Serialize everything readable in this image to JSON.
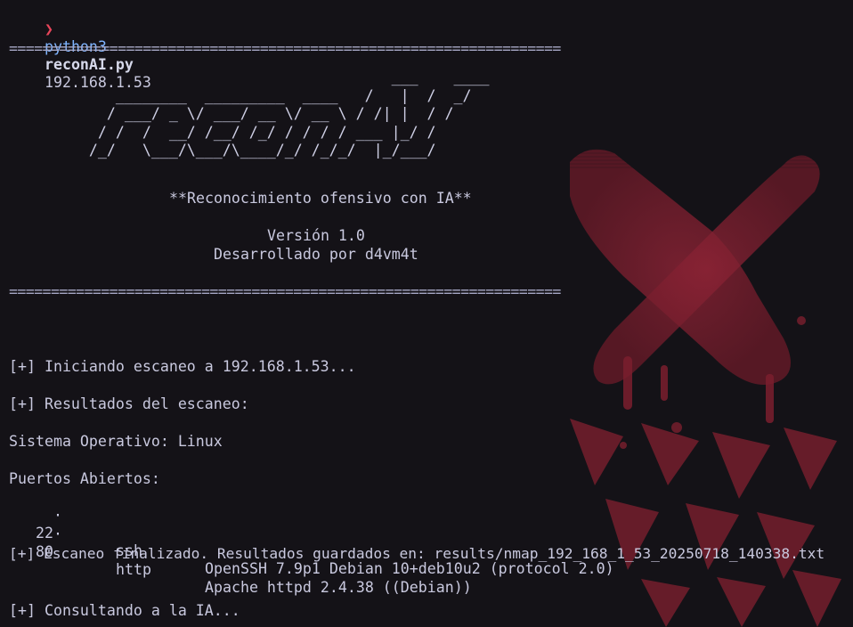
{
  "prompt": {
    "arrow": "❯",
    "command": "python3",
    "script": "reconAI.py",
    "argument": "192.168.1.53"
  },
  "banner": {
    "rule": "==================================================================",
    "ascii_logo": "                                           ___    ____\n            ________  _________  ____   /   |  /  _/\n           / ___/ _ \\/ ___/ __ \\/ __ \\ / /| |  / /\n          / /  /  __/ /__/ /_/ / / / / ___ |_/ /\n         /_/   \\___/\\___/\\____/_/ /_/_/  |_/___/",
    "tagline": "**Reconocimiento ofensivo con IA**",
    "version": "Versión 1.0",
    "author": "Desarrollado por d4vm4t"
  },
  "output": {
    "start_scan": "[+] Iniciando escaneo a 192.168.1.53...",
    "results_header": "[+] Resultados del escaneo:",
    "os_line": "Sistema Operativo: Linux",
    "ports_header": "Puertos Abiertos:",
    "ports": [
      {
        "bullet": "·",
        "port": "22",
        "service": "ssh",
        "version": "OpenSSH 7.9p1 Debian 10+deb10u2 (protocol 2.0)"
      },
      {
        "bullet": "·",
        "port": "80",
        "service": "http",
        "version": "Apache httpd 2.4.38 ((Debian))"
      }
    ],
    "scan_done": "[+] Escaneo finalizado. Resultados guardados en: results/nmap_192_168_1_53_20250718_140338.txt",
    "consulting": "[+] Consultando a la IA..."
  },
  "colors": {
    "background": "#141217",
    "text": "#c9c9df",
    "prompt_arrow": "#e8455a",
    "prompt_command": "#7fb4ff",
    "wallpaper_accent": "#8c2335"
  }
}
